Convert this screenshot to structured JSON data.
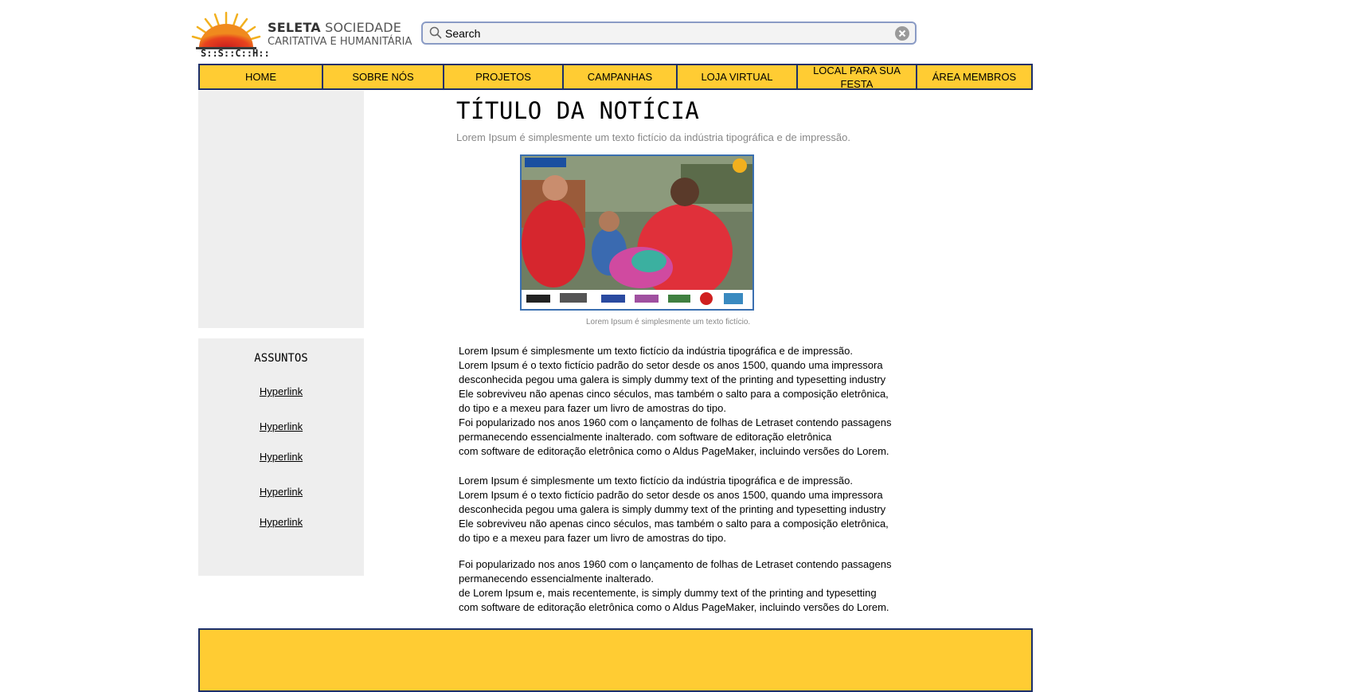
{
  "logo": {
    "line1_bold": "SELETA",
    "line1_rest": "SOCIEDADE",
    "line2": "CARITATIVA E HUMANITÁRIA",
    "abbr": "S::S::C::H::"
  },
  "search": {
    "placeholder": "Search"
  },
  "nav": [
    "HOME",
    "SOBRE NÓS",
    "PROJETOS",
    "CAMPANHAS",
    "LOJA VIRTUAL",
    "LOCAL PARA SUA FESTA",
    "ÁREA MEMBROS"
  ],
  "sidebar": {
    "heading": "ASSUNTOS",
    "links": [
      "Hyperlink",
      "Hyperlink",
      "Hyperlink",
      "Hyperlink",
      "Hyperlink"
    ]
  },
  "article": {
    "title": "TÍTULO DA NOTÍCIA",
    "subtitle": "Lorem Ipsum é simplesmente um texto fictício da indústria tipográfica e de impressão.",
    "image_caption": "Lorem Ipsum é simplesmente um texto fictício.",
    "paragraphs": [
      [
        "Lorem Ipsum é simplesmente um texto fictício da indústria tipográfica e de impressão.",
        "Lorem Ipsum é o texto fictício padrão do setor desde os anos 1500, quando uma impressora",
        "desconhecida pegou uma galera is simply dummy text of the printing and typesetting industry",
        "Ele sobreviveu não apenas cinco séculos, mas também o salto para a composição eletrônica,",
        "do tipo e a mexeu para fazer um livro de amostras do tipo.",
        "Foi popularizado nos anos 1960 com o lançamento de folhas de Letraset contendo passagens",
        "permanecendo essencialmente inalterado. com software de editoração eletrônica",
        "com software de editoração eletrônica como o Aldus PageMaker, incluindo versões do Lorem."
      ],
      [
        "Lorem Ipsum é simplesmente um texto fictício da indústria tipográfica e de impressão.",
        "Lorem Ipsum é o texto fictício padrão do setor desde os anos 1500, quando uma impressora",
        "desconhecida pegou uma galera is simply dummy text of the printing and typesetting industry",
        "Ele sobreviveu não apenas cinco séculos, mas também o salto para a composição eletrônica,",
        "do tipo e a mexeu para fazer um livro de amostras do tipo."
      ],
      [
        "Foi popularizado nos anos 1960 com o lançamento de folhas de Letraset contendo passagens",
        "permanecendo essencialmente inalterado.",
        "de Lorem Ipsum e, mais recentemente, is simply dummy text of the printing and typesetting",
        "com software de editoração eletrônica como o Aldus PageMaker, incluindo versões do Lorem."
      ]
    ]
  },
  "colors": {
    "nav_bg": "#ffcc33",
    "nav_border": "#1c2f6a",
    "sidebar_bg": "#eeeeee",
    "subtitle_text": "#888888"
  },
  "icons": [
    "magnifier-icon",
    "clear-circle-x-icon",
    "sun-logo-icon"
  ]
}
